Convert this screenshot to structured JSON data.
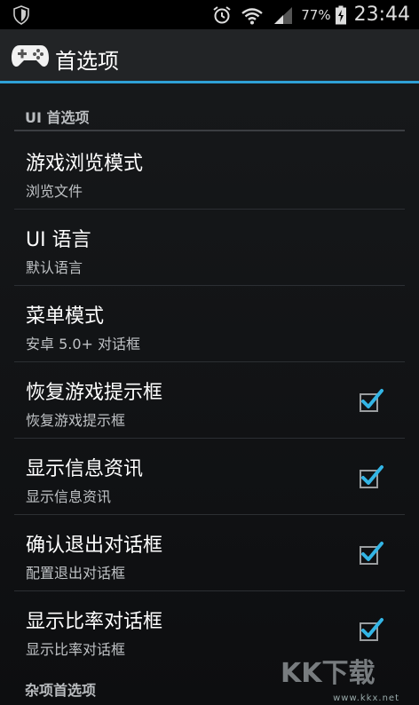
{
  "status_bar": {
    "battery_percent": "77%",
    "time": "23:44",
    "icons": [
      "shield-icon",
      "alarm-icon",
      "wifi-icon",
      "signal-icon",
      "battery-charging-icon"
    ]
  },
  "action_bar": {
    "title": "首选项",
    "icon": "gamepad-icon",
    "accent_color": "#2ea0d6"
  },
  "sections": [
    {
      "header": "UI 首选项"
    },
    {
      "header": "杂项首选项"
    }
  ],
  "prefs": [
    {
      "title": "游戏浏览模式",
      "summary": "浏览文件"
    },
    {
      "title": "UI 语言",
      "summary": "默认语言"
    },
    {
      "title": "菜单模式",
      "summary": "安卓 5.0+ 对话框"
    },
    {
      "title": "恢复游戏提示框",
      "summary": "恢复游戏提示框",
      "checked": true
    },
    {
      "title": "显示信息资讯",
      "summary": "显示信息资讯",
      "checked": true
    },
    {
      "title": "确认退出对话框",
      "summary": "配置退出对话框",
      "checked": true
    },
    {
      "title": "显示比率对话框",
      "summary": "显示比率对话框",
      "checked": true
    }
  ],
  "watermark": {
    "logo_text": "KK下载",
    "url": "www.kkx.net"
  }
}
